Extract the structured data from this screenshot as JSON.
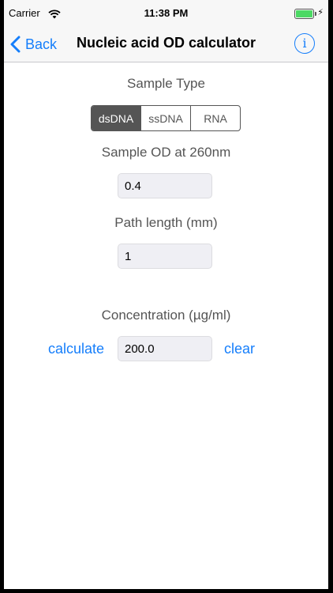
{
  "status": {
    "carrier": "Carrier",
    "time": "11:38 PM"
  },
  "nav": {
    "back_label": "Back",
    "title": "Nucleic acid OD calculator",
    "info_glyph": "i"
  },
  "sample_type": {
    "label": "Sample Type",
    "options": [
      "dsDNA",
      "ssDNA",
      "RNA"
    ],
    "selected": "dsDNA"
  },
  "od": {
    "label": "Sample OD at 260nm",
    "value": "0.4"
  },
  "path_length": {
    "label": "Path length (mm)",
    "value": "1"
  },
  "concentration": {
    "label": "Concentration (µg/ml)",
    "value": "200.0"
  },
  "actions": {
    "calculate_label": "calculate",
    "clear_label": "clear"
  },
  "colors": {
    "accent": "#157efb",
    "segment": "#555555",
    "field_bg": "#efeff4"
  }
}
